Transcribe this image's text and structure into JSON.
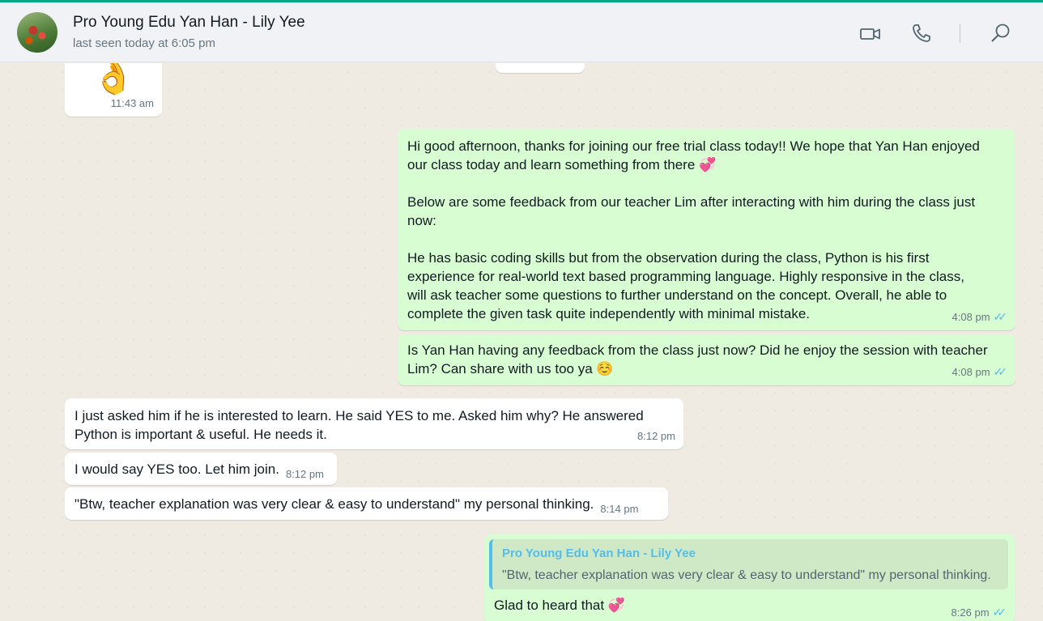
{
  "header": {
    "contact_name": "Pro Young Edu Yan Han - Lily Yee",
    "status": "last seen today at 6:05 pm",
    "icons": [
      "video-call-icon",
      "voice-call-icon",
      "search-icon"
    ]
  },
  "colors": {
    "accent": "#00a884",
    "outgoing_bubble": "#d9fdd3",
    "incoming_bubble": "#ffffff",
    "read_ticks": "#53bdeb",
    "chat_background": "#efeae2"
  },
  "messages": [
    {
      "direction": "in",
      "type": "emoji",
      "text": "👌",
      "time": "11:43 am"
    },
    {
      "direction": "out",
      "text": "Hi good afternoon, thanks for joining our free trial class today!! We hope that Yan Han enjoyed\nour class today and learn something from there 💞\n\nBelow are some feedback from our teacher Lim after interacting with him during the class just\nnow:\n\nHe has basic coding skills but from the observation during the class, Python is his first\nexperience for real-world text based programming language. Highly responsive in the class,\nwill ask teacher some questions to further understand on the concept. Overall, he able to\ncomplete the given task quite independently with minimal mistake.",
      "time": "4:08 pm",
      "status": "read"
    },
    {
      "direction": "out",
      "text": "Is Yan Han having any feedback from the class just now? Did he enjoy the session with teacher\nLim? Can share with us too ya ☺️",
      "time": "4:08 pm",
      "status": "read"
    },
    {
      "direction": "in",
      "text": "I just asked him if he is interested to learn. He said YES to me. Asked him why? He answered\nPython is important & useful. He needs it.",
      "time": "8:12 pm"
    },
    {
      "direction": "in",
      "text": "I would say YES too. Let him join.",
      "time": "8:12 pm"
    },
    {
      "direction": "in",
      "text": "\"Btw, teacher explanation was very clear & easy to understand\" my personal thinking.",
      "time": "8:14 pm"
    },
    {
      "direction": "out",
      "quote": {
        "author": "Pro Young Edu Yan Han - Lily Yee",
        "text": "\"Btw, teacher explanation was very clear & easy to understand\" my personal thinking."
      },
      "text": "Glad to heard that 💞",
      "time": "8:26 pm",
      "status": "read"
    }
  ]
}
